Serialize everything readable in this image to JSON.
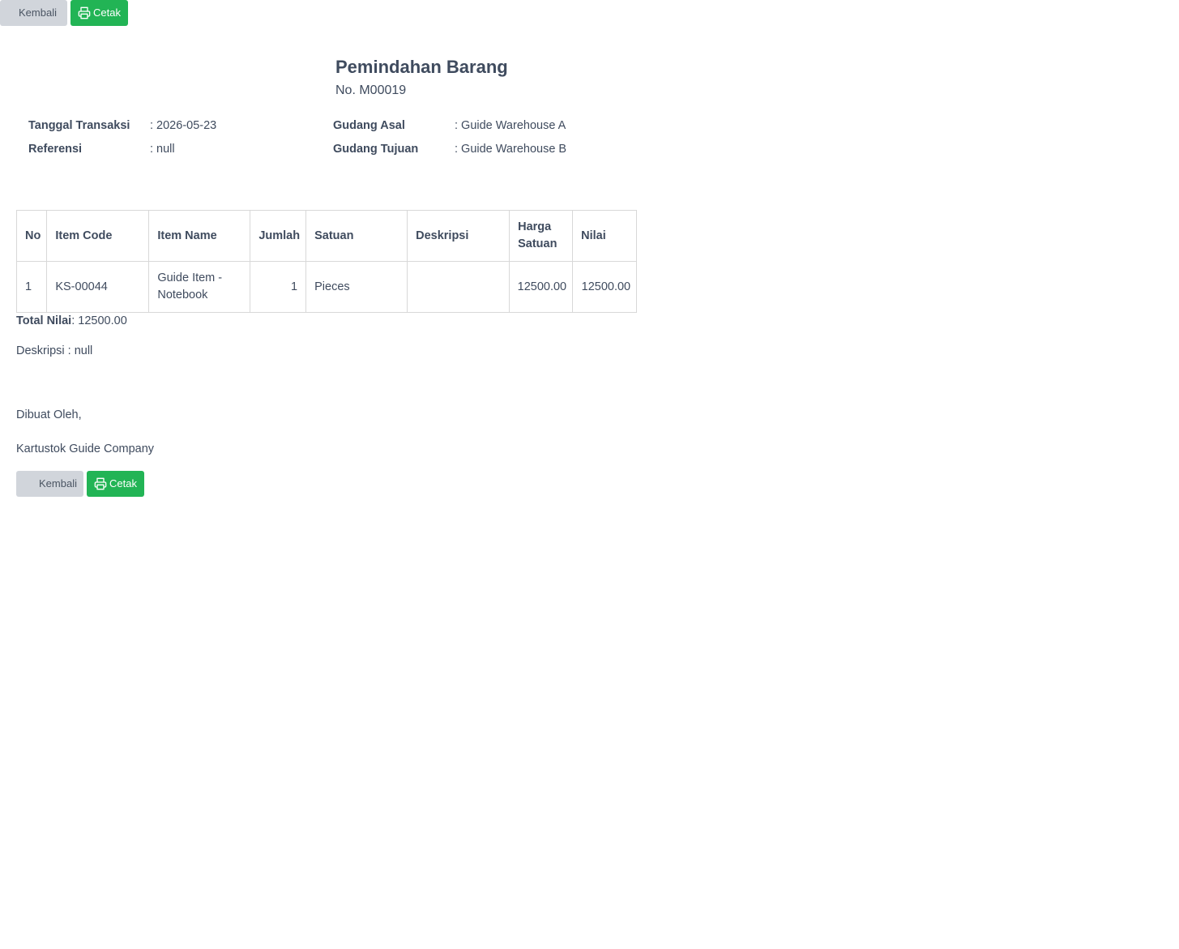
{
  "toolbar_top": {
    "back_label": "Kembali",
    "print_label": "Cetak"
  },
  "document": {
    "title": "Pemindahan Barang",
    "number": "No. M00019"
  },
  "meta": {
    "tanggal_label": "Tanggal Transaksi",
    "tanggal_value": ": 2026-05-23",
    "referensi_label": "Referensi",
    "referensi_value": ": null",
    "gudang_asal_label": "Gudang Asal",
    "gudang_asal_value": ": Guide Warehouse A",
    "gudang_tujuan_label": "Gudang Tujuan",
    "gudang_tujuan_value": ": Guide Warehouse B"
  },
  "table": {
    "headers": [
      "No",
      "Item Code",
      "Item Name",
      "Jumlah",
      "Satuan",
      "Deskripsi",
      "Harga Satuan",
      "Nilai"
    ],
    "rows": [
      {
        "no": "1",
        "item_code": "KS-00044",
        "item_name": "Guide Item - Notebook",
        "jumlah": "1",
        "satuan": "Pieces",
        "deskripsi": "",
        "harga_satuan": "12500.00",
        "nilai": "12500.00"
      }
    ]
  },
  "summary": {
    "total_label": "Total Nilai",
    "total_value": ": 12500.00",
    "deskripsi_text": "Deskripsi : null"
  },
  "signature": {
    "made_by": "Dibuat Oleh,",
    "company": "Kartustok Guide Company"
  },
  "toolbar_bottom": {
    "back_label": "Kembali",
    "print_label": "Cetak"
  },
  "colors": {
    "print_button": "#22b455",
    "back_button": "#d1d5db",
    "text": "#3f4b5e"
  },
  "icons": {
    "print": "printer-icon"
  }
}
